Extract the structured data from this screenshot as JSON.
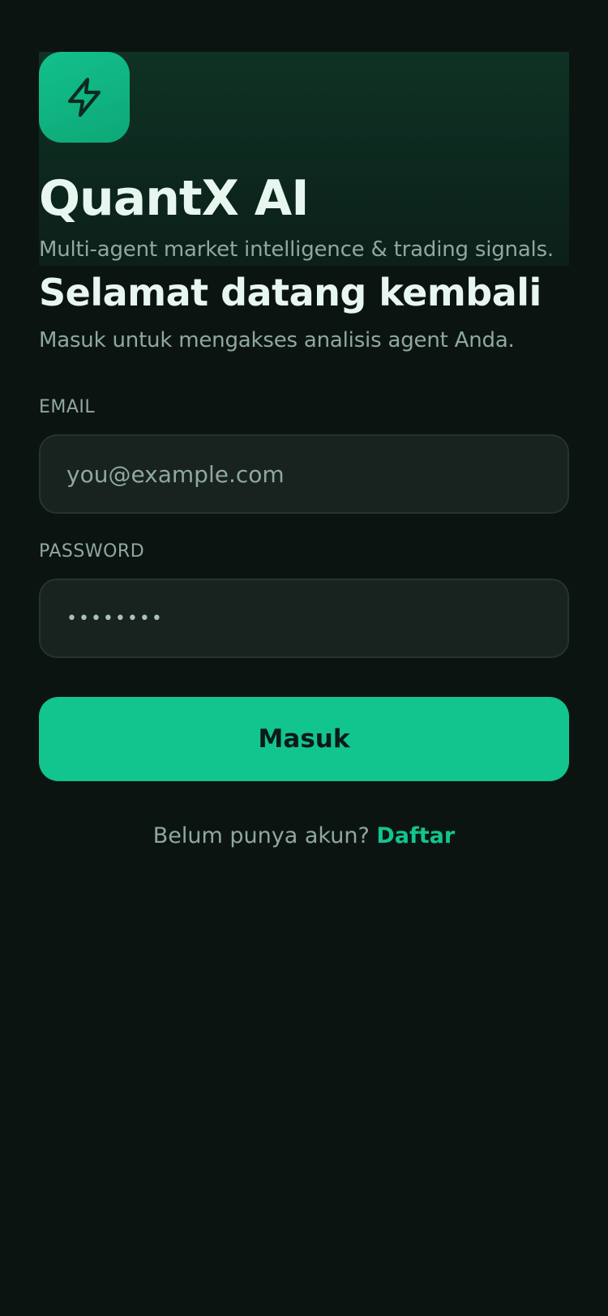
{
  "brand": {
    "icon": "lightning-bolt-icon",
    "title": "QuantX AI",
    "subtitle": "Multi-agent market intelligence & trading signals.",
    "accent_color": "#12c48e"
  },
  "login": {
    "heading": "Selamat datang kembali",
    "subheading": "Masuk untuk mengakses analisis agent Anda.",
    "email": {
      "label": "EMAIL",
      "placeholder": "you@example.com",
      "value": ""
    },
    "password": {
      "label": "PASSWORD",
      "value": "••••••••"
    },
    "submit_label": "Masuk",
    "signup_prompt": "Belum punya akun?",
    "signup_link": "Daftar"
  }
}
